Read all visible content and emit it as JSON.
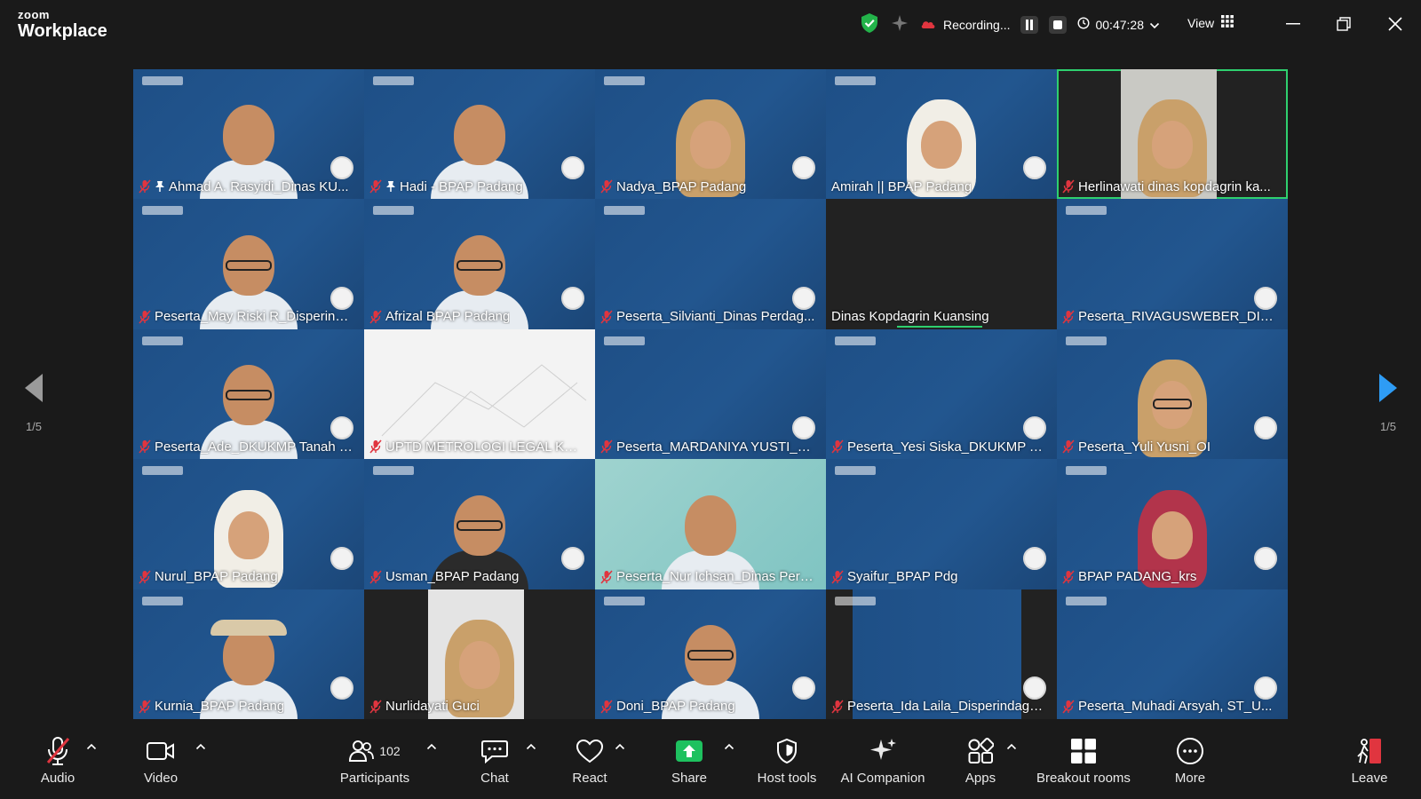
{
  "app": {
    "brand_top": "zoom",
    "brand_bottom": "Workplace"
  },
  "recording": {
    "label": "Recording...",
    "timer": "00:47:28"
  },
  "view_label": "View",
  "pager": {
    "left": "1/5",
    "right": "1/5"
  },
  "colors": {
    "active_speaker": "#2fd06f",
    "muted": "#e0353f",
    "share": "#1ec15f",
    "accent": "#0e72ed"
  },
  "participants": [
    {
      "name": "Ahmad A. Rasyidi_Dinas KU...",
      "muted": true,
      "pinned": true,
      "tile": "banner",
      "avatar": "man"
    },
    {
      "name": "Hadi - BPAP Padang",
      "muted": true,
      "pinned": true,
      "tile": "banner",
      "avatar": "man"
    },
    {
      "name": "Nadya_BPAP Padang",
      "muted": true,
      "pinned": false,
      "tile": "banner",
      "avatar": "hijab"
    },
    {
      "name": "Amirah || BPAP Padang",
      "muted": false,
      "pinned": false,
      "tile": "banner",
      "avatar": "hijab-white"
    },
    {
      "name": "Herlinawati dinas kopdagrin ka...",
      "muted": true,
      "pinned": false,
      "tile": "dark-video",
      "avatar": "hijab",
      "active": true
    },
    {
      "name": "Peserta_May Riski R_Disperinda...",
      "muted": true,
      "pinned": false,
      "tile": "banner",
      "avatar": "man-glasses"
    },
    {
      "name": "Afrizal BPAP Padang",
      "muted": true,
      "pinned": false,
      "tile": "banner",
      "avatar": "man-glasses"
    },
    {
      "name": "Peserta_Silvianti_Dinas Perdag...",
      "muted": true,
      "pinned": false,
      "tile": "banner",
      "avatar": "none"
    },
    {
      "name": "Dinas Kopdagrin Kuansing",
      "muted": false,
      "pinned": false,
      "tile": "dark",
      "avatar": "none"
    },
    {
      "name": "Peserta_RIVAGUSWEBER_DISPE...",
      "muted": true,
      "pinned": false,
      "tile": "banner",
      "avatar": "none"
    },
    {
      "name": "Peserta_Ade_DKUKMP Tanah D...",
      "muted": true,
      "pinned": false,
      "tile": "banner",
      "avatar": "man-glasses"
    },
    {
      "name": "UPTD METROLOGI LEGAL KOTA...",
      "muted": true,
      "pinned": false,
      "tile": "white",
      "avatar": "none"
    },
    {
      "name": "Peserta_MARDANIYA YUSTI_DI...",
      "muted": true,
      "pinned": false,
      "tile": "banner",
      "avatar": "none"
    },
    {
      "name": "Peserta_Yesi Siska_DKUKMP Ta...",
      "muted": true,
      "pinned": false,
      "tile": "banner",
      "avatar": "none"
    },
    {
      "name": "Peserta_Yuli Yusni_OI",
      "muted": true,
      "pinned": false,
      "tile": "banner",
      "avatar": "hijab-glasses"
    },
    {
      "name": "Nurul_BPAP Padang",
      "muted": true,
      "pinned": false,
      "tile": "banner",
      "avatar": "hijab-white"
    },
    {
      "name": "Usman_BPAP Padang",
      "muted": true,
      "pinned": false,
      "tile": "banner",
      "avatar": "man-glasses"
    },
    {
      "name": "Peserta_Nur Ichsan_Dinas Perd...",
      "muted": true,
      "pinned": false,
      "tile": "teal",
      "avatar": "man"
    },
    {
      "name": "Syaifur_BPAP Pdg",
      "muted": true,
      "pinned": false,
      "tile": "banner",
      "avatar": "none"
    },
    {
      "name": "BPAP PADANG_krs",
      "muted": true,
      "pinned": false,
      "tile": "banner",
      "avatar": "hijab"
    },
    {
      "name": "Kurnia_BPAP Padang",
      "muted": true,
      "pinned": false,
      "tile": "banner",
      "avatar": "man-hat"
    },
    {
      "name": "Nurlidayati Guci",
      "muted": true,
      "pinned": false,
      "tile": "dark-video",
      "avatar": "hijab"
    },
    {
      "name": "Doni_BPAP Padang",
      "muted": true,
      "pinned": false,
      "tile": "banner",
      "avatar": "man-glasses"
    },
    {
      "name": "Peserta_Ida Laila_Disperindagk...",
      "muted": true,
      "pinned": false,
      "tile": "banner-narrow",
      "avatar": "none"
    },
    {
      "name": "Peserta_Muhadi Arsyah, ST_U...",
      "muted": true,
      "pinned": false,
      "tile": "banner",
      "avatar": "none"
    }
  ],
  "toolbar": {
    "audio": "Audio",
    "video": "Video",
    "participants": "Participants",
    "participants_count": "102",
    "chat": "Chat",
    "react": "React",
    "share": "Share",
    "host_tools": "Host tools",
    "ai_companion": "AI Companion",
    "apps": "Apps",
    "breakout_rooms": "Breakout rooms",
    "more": "More",
    "leave": "Leave"
  }
}
